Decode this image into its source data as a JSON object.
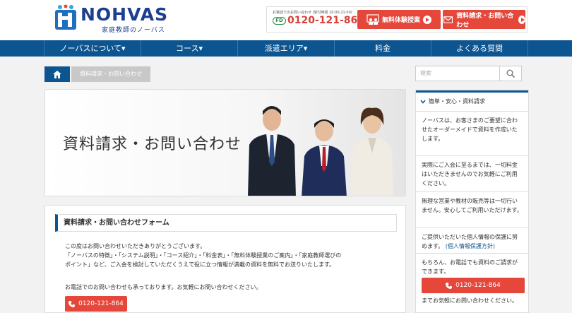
{
  "logo": {
    "name": "NOHVAS",
    "subtitle": "家庭教師のノーバス"
  },
  "contact": {
    "small_text": "お電話でのお問い合わせ (受付時間 10:00-21:00)",
    "phone": "0120-121-864",
    "free_dial_mark": "FD",
    "trial_button": "無料体験授業",
    "request_button": "資料請求・お問い合わせ"
  },
  "nav": {
    "items": [
      "ノーバスについて▾",
      "コース▾",
      "派遣エリア▾",
      "料金",
      "よくある質問"
    ]
  },
  "breadcrumb": {
    "current": "資料請求・お問い合わせ"
  },
  "hero": {
    "title": "資料請求・お問い合わせ"
  },
  "form_card": {
    "heading": "資料請求・お問い合わせフォーム",
    "intro_lines": [
      "この度はお問い合わせいただきありがとうございます。",
      "「ノーバスの特徴」・「システム説明」・「コース紹介」・「料金表」・「無料体験授業のご案内」・「家庭教師選びの",
      "ポイント」など、ご入会を検討していただくうえで役に立つ情報が満載の資料を無料でお送りいたします。"
    ],
    "phone_text": "お電話でのお問い合わせも承っております。お気軽にお問い合わせください。",
    "phone_button": "0120-121-864"
  },
  "search": {
    "placeholder": "検索"
  },
  "sidebar": {
    "heading": "簡単・安心・資料請求",
    "sections": [
      "ノーバスは、お客さまのご要望に合わせたオーダーメイドで資料を作成いたします。",
      "実際にご入会に至るまでは、一切料金はいただきませんのでお気軽にご利用ください。",
      "無理な営業や教材の販売等は一切行いません。安心してご利用いただけます。"
    ],
    "privacy_text": "ご提供いただいた個人情報の保護に努めます。",
    "privacy_link": "(個人情報保護方針)",
    "phone_intro": "もちろん、お電話でも資料のご請求ができます。",
    "phone_button": "0120-121-864",
    "phone_outro": "までお気軽にお問い合わせください。"
  },
  "colors": {
    "brand_blue": "#0d5590",
    "accent_red": "#e5473b"
  }
}
